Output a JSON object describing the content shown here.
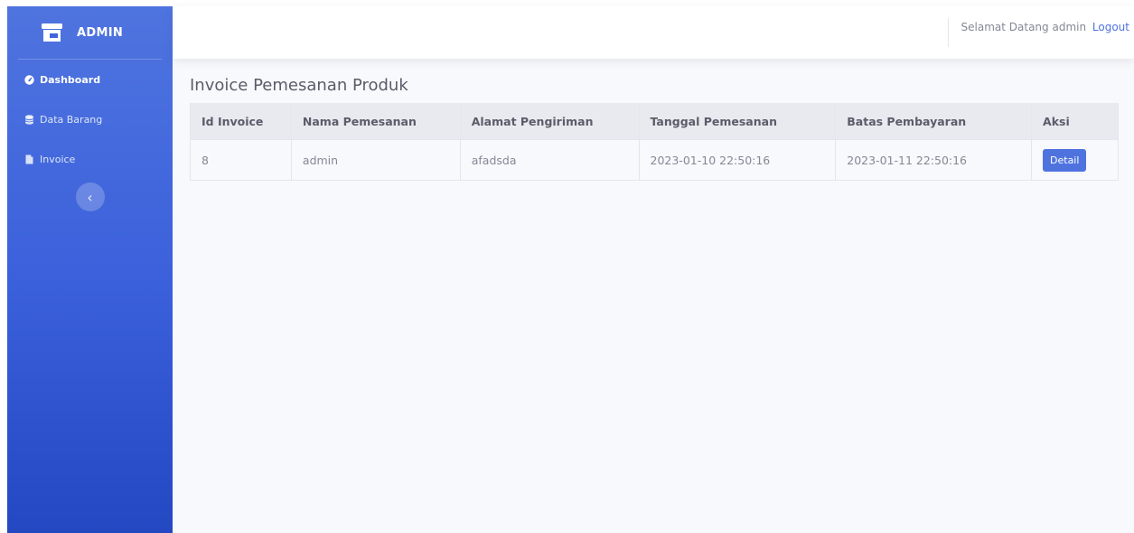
{
  "brand": {
    "name": "ADMIN"
  },
  "sidebar": {
    "items": [
      {
        "label": "Dashboard",
        "icon": "tachometer-icon"
      },
      {
        "label": "Data Barang",
        "icon": "database-icon"
      },
      {
        "label": "Invoice",
        "icon": "file-icon"
      }
    ],
    "toggle_glyph": "‹"
  },
  "topbar": {
    "welcome": "Selamat Datang admin",
    "logout": "Logout"
  },
  "page": {
    "title": "Invoice Pemesanan Produk"
  },
  "table": {
    "headers": [
      "Id Invoice",
      "Nama Pemesanan",
      "Alamat Pengiriman",
      "Tanggal Pemesanan",
      "Batas Pembayaran",
      "Aksi"
    ],
    "rows": [
      {
        "id": "8",
        "nama": "admin",
        "alamat": "afadsda",
        "tanggal": "2023-01-10 22:50:16",
        "batas": "2023-01-11 22:50:16",
        "action": "Detail"
      }
    ]
  },
  "colors": {
    "primary": "#4e73df",
    "sidebar_top": "#4f74df",
    "sidebar_bottom": "#2447c2",
    "text_muted": "#858796"
  }
}
